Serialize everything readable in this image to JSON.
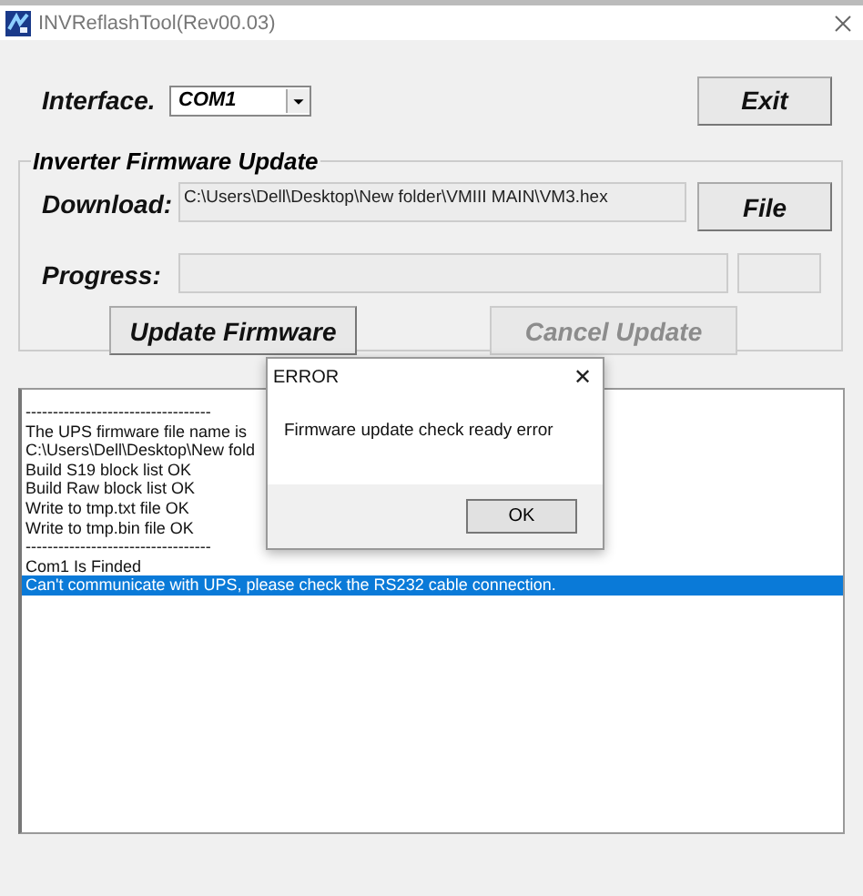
{
  "window": {
    "title": "INVReflashTool(Rev00.03)"
  },
  "interface": {
    "label": "Interface.",
    "value": "COM1"
  },
  "exit_button": "Exit",
  "firmware_group": {
    "title": "Inverter Firmware Update",
    "download": {
      "label": "Download:",
      "value": "C:\\Users\\Dell\\Desktop\\New folder\\VMIII MAIN\\VM3.hex"
    },
    "file_button": "File",
    "progress": {
      "label": "Progress:"
    },
    "buttons": [
      {
        "label": "Update Firmware",
        "disabled": false
      },
      {
        "label": "Cancel Update",
        "disabled": true
      }
    ]
  },
  "log": [
    {
      "text": "----------------------------------",
      "selected": false
    },
    {
      "text": "The UPS firmware file name is",
      "selected": false
    },
    {
      "text": "C:\\Users\\Dell\\Desktop\\New fold",
      "selected": false
    },
    {
      "text": "Build S19 block list OK",
      "selected": false
    },
    {
      "text": "Build Raw block list OK",
      "selected": false
    },
    {
      "text": "Write to tmp.txt file OK",
      "selected": false
    },
    {
      "text": "Write to tmp.bin file OK",
      "selected": false
    },
    {
      "text": "----------------------------------",
      "selected": false
    },
    {
      "text": "Com1 Is Finded",
      "selected": false
    },
    {
      "text": "Can't communicate with UPS, please check the RS232 cable connection.",
      "selected": true
    }
  ],
  "dialog": {
    "title": "ERROR",
    "close": "✕",
    "message": "Firmware update check ready error",
    "ok_button": "OK"
  }
}
